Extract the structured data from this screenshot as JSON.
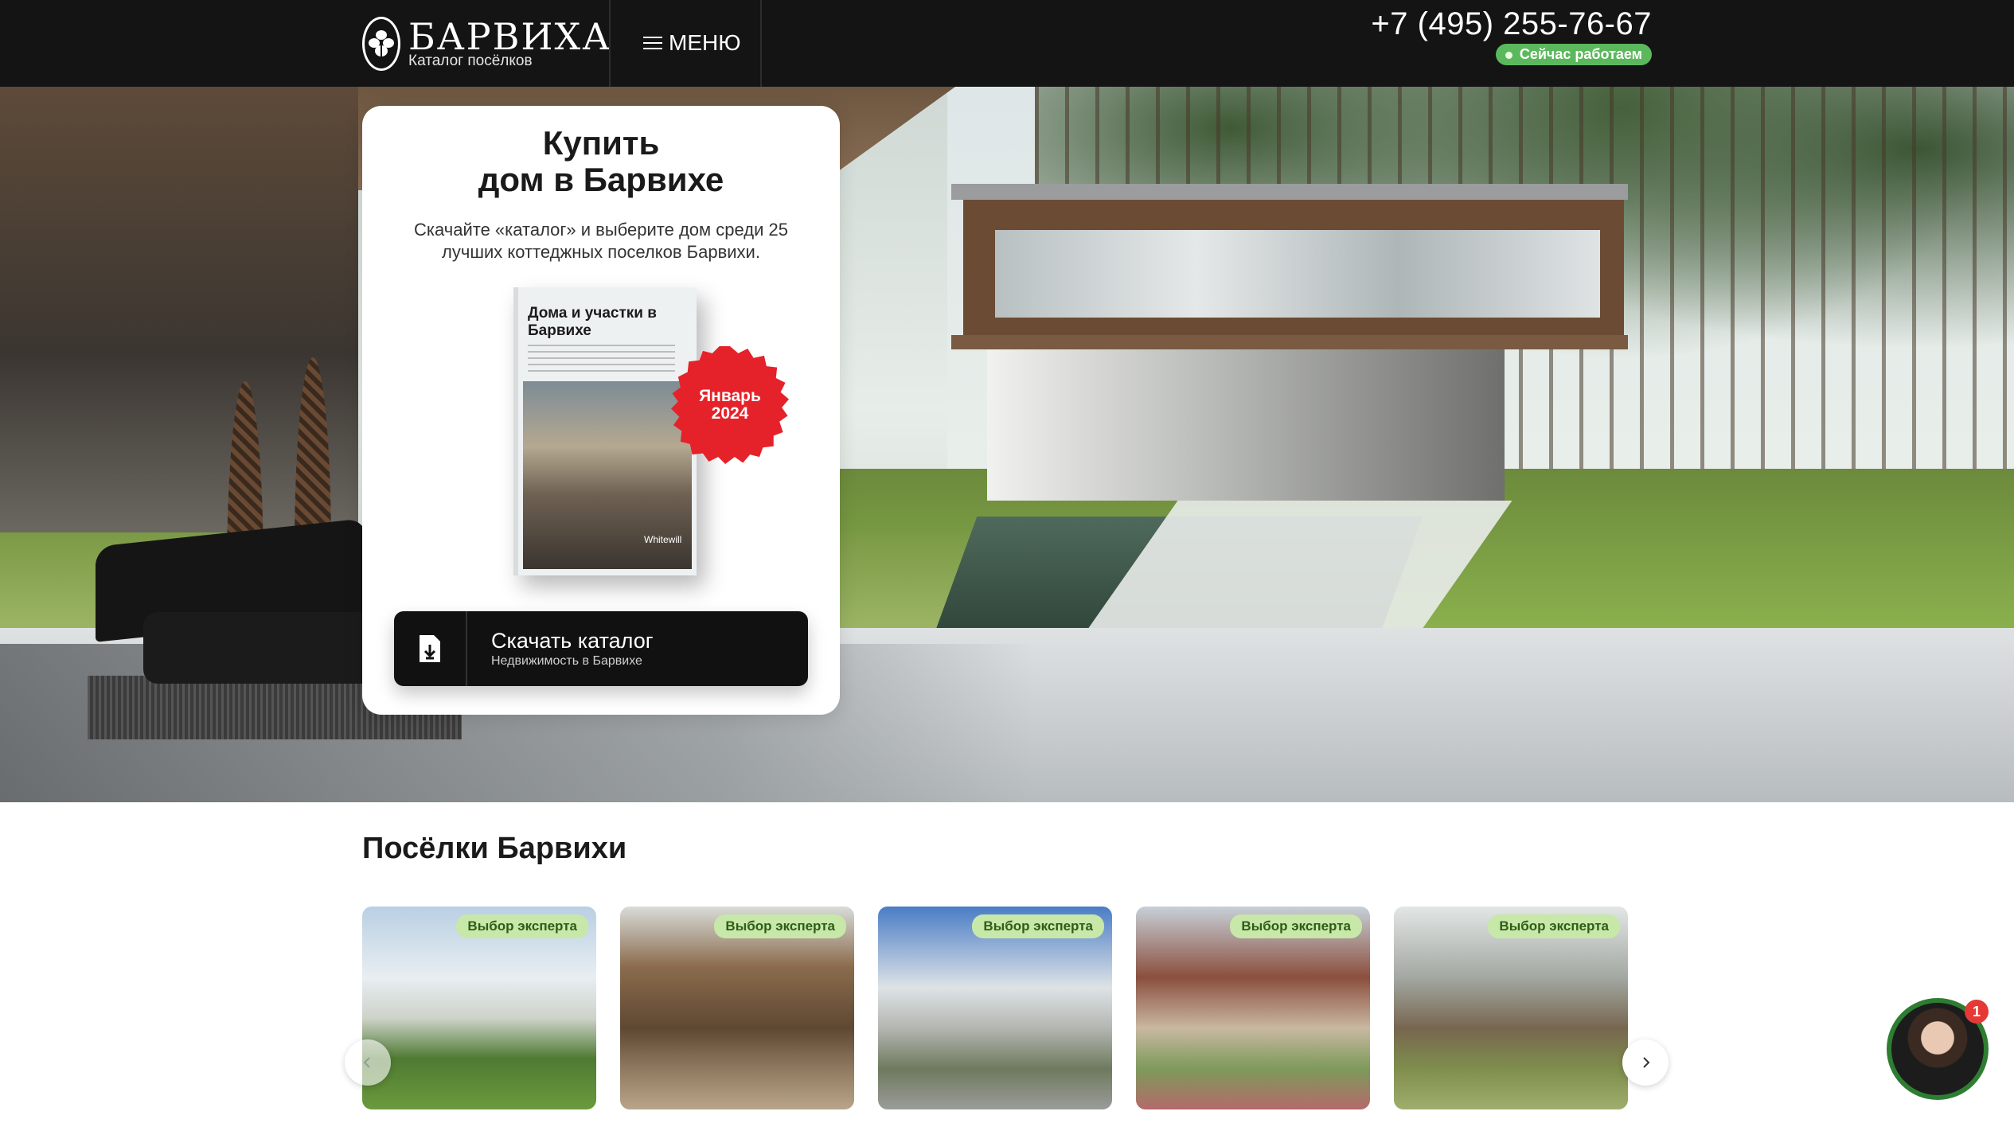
{
  "header": {
    "logo_title": "БАРВИХА",
    "logo_subtitle": "Каталог посёлков",
    "menu_label": "МЕНЮ",
    "phone": "+7 (495) 255-76-67",
    "status": "Сейчас работаем"
  },
  "hero": {
    "title_line1": "Купить",
    "title_line2": "дом в Барвихе",
    "text": "Скачайте «каталог» и выберите дом среди 25 лучших коттеджных поселков Барвихи.",
    "book_title": "Дома и участки в Барвихе",
    "book_brand": "Whitewill",
    "badge_line1": "Январь",
    "badge_line2": "2024",
    "download_label": "Скачать каталог",
    "download_sub": "Недвижимость в Барвихе"
  },
  "section": {
    "title": "Посёлки Барвихи",
    "cards": [
      {
        "badge": "Выбор эксперта"
      },
      {
        "badge": "Выбор эксперта"
      },
      {
        "badge": "Выбор эксперта"
      },
      {
        "badge": "Выбор эксперта"
      },
      {
        "badge": "Выбор эксперта"
      }
    ]
  },
  "chat": {
    "count": "1"
  },
  "colors": {
    "header_bg": "#141414",
    "status_green": "#5cb85c",
    "badge_red": "#e5222a",
    "expert_badge": "#c7e8a8"
  }
}
